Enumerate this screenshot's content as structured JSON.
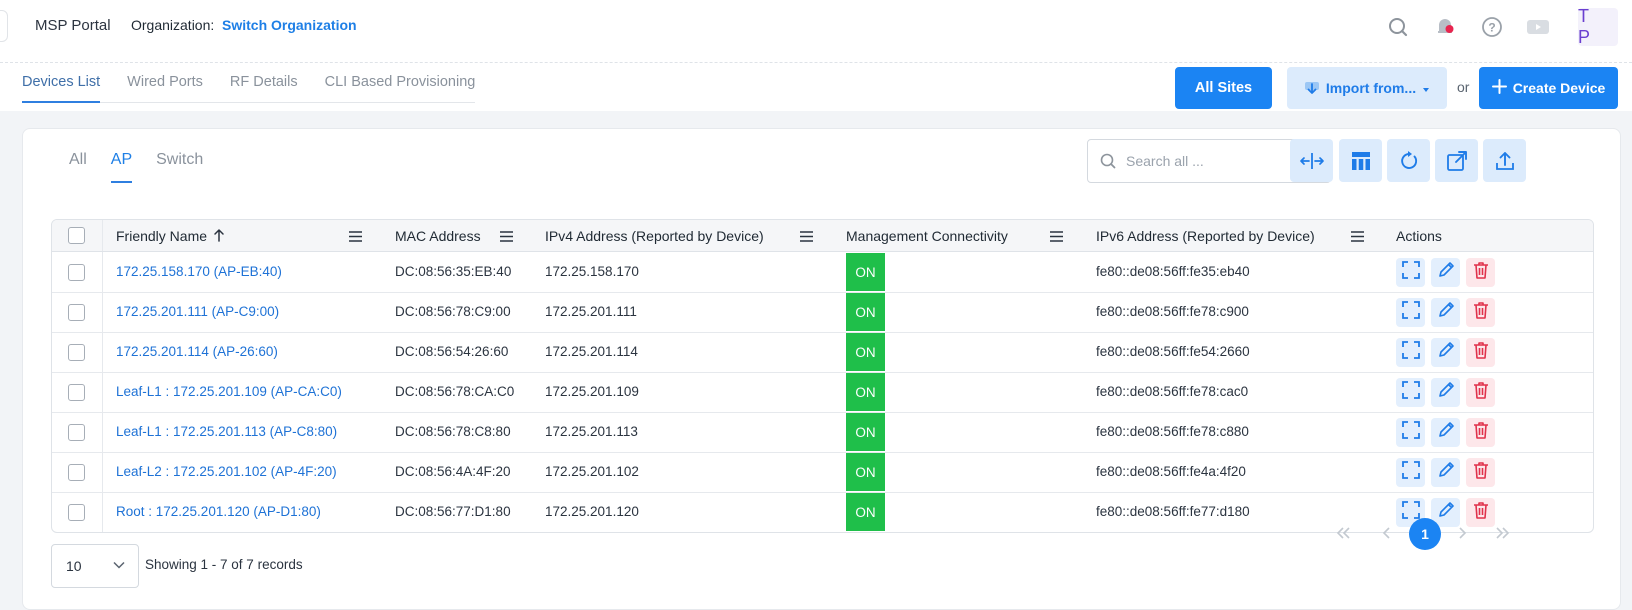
{
  "header": {
    "brand": "MSP Portal",
    "org_label": "Organization:",
    "org_value": "Switch Organization",
    "avatar_initials": "T P"
  },
  "subnav": {
    "tabs": [
      "Devices List",
      "Wired Ports",
      "RF Details",
      "CLI Based Provisioning"
    ],
    "active_tab": "Devices List",
    "all_sites": "All Sites",
    "import_label": "Import from...",
    "or_text": "or",
    "create_label": "Create Device"
  },
  "filters": {
    "tabs": [
      "All",
      "AP",
      "Switch"
    ],
    "active": "AP",
    "search_placeholder": "Search all ..."
  },
  "table": {
    "columns": [
      "Friendly Name",
      "MAC Address",
      "IPv4 Address (Reported by Device)",
      "Management Connectivity",
      "IPv6 Address (Reported by Device)",
      "Actions"
    ],
    "rows": [
      {
        "name": "172.25.158.170 (AP-EB:40)",
        "mac": "DC:08:56:35:EB:40",
        "ipv4": "172.25.158.170",
        "status": "ON",
        "ipv6": "fe80::de08:56ff:fe35:eb40"
      },
      {
        "name": "172.25.201.111 (AP-C9:00)",
        "mac": "DC:08:56:78:C9:00",
        "ipv4": "172.25.201.111",
        "status": "ON",
        "ipv6": "fe80::de08:56ff:fe78:c900"
      },
      {
        "name": "172.25.201.114 (AP-26:60)",
        "mac": "DC:08:56:54:26:60",
        "ipv4": "172.25.201.114",
        "status": "ON",
        "ipv6": "fe80::de08:56ff:fe54:2660"
      },
      {
        "name": "Leaf-L1 : 172.25.201.109 (AP-CA:C0)",
        "mac": "DC:08:56:78:CA:C0",
        "ipv4": "172.25.201.109",
        "status": "ON",
        "ipv6": "fe80::de08:56ff:fe78:cac0"
      },
      {
        "name": "Leaf-L1 : 172.25.201.113 (AP-C8:80)",
        "mac": "DC:08:56:78:C8:80",
        "ipv4": "172.25.201.113",
        "status": "ON",
        "ipv6": "fe80::de08:56ff:fe78:c880"
      },
      {
        "name": "Leaf-L2 : 172.25.201.102 (AP-4F:20)",
        "mac": "DC:08:56:4A:4F:20",
        "ipv4": "172.25.201.102",
        "status": "ON",
        "ipv6": "fe80::de08:56ff:fe4a:4f20"
      },
      {
        "name": "Root : 172.25.201.120 (AP-D1:80)",
        "mac": "DC:08:56:77:D1:80",
        "ipv4": "172.25.201.120",
        "status": "ON",
        "ipv6": "fe80::de08:56ff:fe77:d180"
      }
    ]
  },
  "footer": {
    "page_size": "10",
    "records_text": "Showing 1 - 7 of 7 records",
    "current_page": "1"
  },
  "colors": {
    "accent": "#1b84f3",
    "status_on": "#1fbf4a",
    "delete": "#e0314b"
  }
}
